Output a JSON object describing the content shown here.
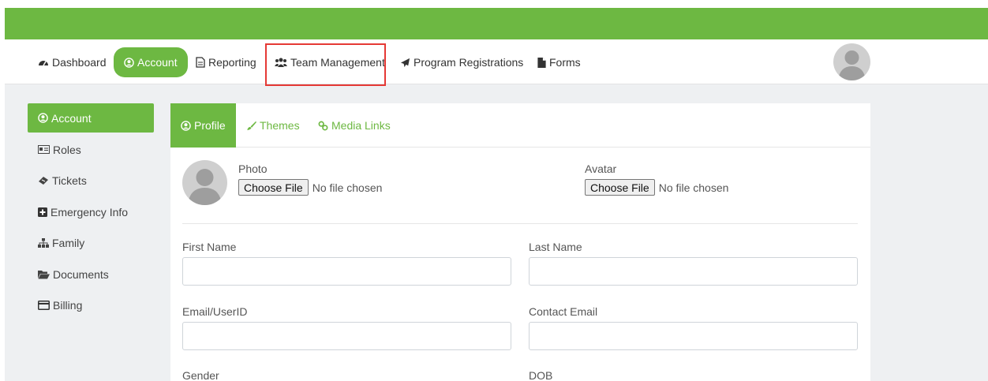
{
  "nav": {
    "items": [
      {
        "label": "Dashboard",
        "icon": "dashboard-icon"
      },
      {
        "label": "Account",
        "icon": "user-circle-icon",
        "active": true
      },
      {
        "label": "Reporting",
        "icon": "report-file-icon"
      },
      {
        "label": "Team Management",
        "icon": "users-icon",
        "highlighted": true
      },
      {
        "label": "Program Registrations",
        "icon": "paper-plane-icon"
      },
      {
        "label": "Forms",
        "icon": "file-icon"
      }
    ]
  },
  "sidebar": {
    "items": [
      {
        "label": "Account",
        "icon": "user-circle-icon",
        "active": true
      },
      {
        "label": "Roles",
        "icon": "id-card-icon"
      },
      {
        "label": "Tickets",
        "icon": "ticket-icon"
      },
      {
        "label": "Emergency Info",
        "icon": "plus-square-icon"
      },
      {
        "label": "Family",
        "icon": "sitemap-icon"
      },
      {
        "label": "Documents",
        "icon": "folder-open-icon"
      },
      {
        "label": "Billing",
        "icon": "credit-card-icon"
      }
    ]
  },
  "tabs": [
    {
      "label": "Profile",
      "icon": "user-circle-icon",
      "active": true
    },
    {
      "label": "Themes",
      "icon": "brush-icon"
    },
    {
      "label": "Media Links",
      "icon": "link-icon"
    }
  ],
  "profile": {
    "photo_label": "Photo",
    "avatar_label": "Avatar",
    "choose_file": "Choose File",
    "no_file": "No file chosen",
    "first_name_label": "First Name",
    "last_name_label": "Last Name",
    "email_label": "Email/UserID",
    "contact_email_label": "Contact Email",
    "gender_label": "Gender",
    "dob_label": "DOB",
    "first_name_value": "",
    "last_name_value": "",
    "email_value": "",
    "contact_email_value": ""
  },
  "colors": {
    "accent": "#6db842",
    "highlight": "#e53935"
  }
}
